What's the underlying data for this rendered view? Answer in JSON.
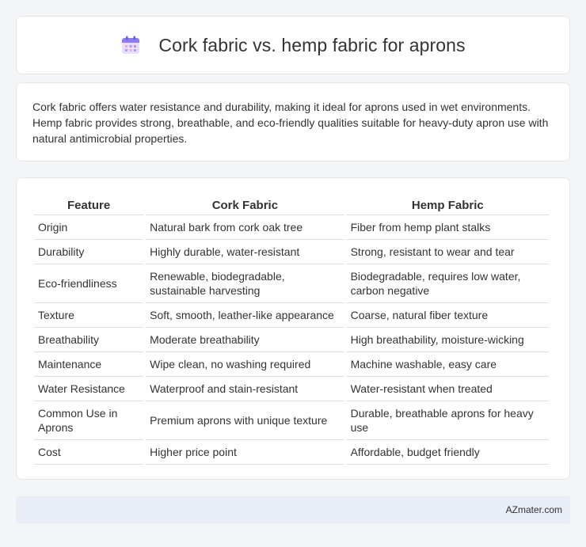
{
  "header": {
    "title": "Cork fabric vs. hemp fabric for aprons",
    "icon": "calendar-icon"
  },
  "intro": {
    "text": "Cork fabric offers water resistance and durability, making it ideal for aprons used in wet environments. Hemp fabric provides strong, breathable, and eco-friendly qualities suitable for heavy-duty apron use with natural antimicrobial properties."
  },
  "table": {
    "headers": [
      "Feature",
      "Cork Fabric",
      "Hemp Fabric"
    ],
    "rows": [
      [
        "Origin",
        "Natural bark from cork oak tree",
        "Fiber from hemp plant stalks"
      ],
      [
        "Durability",
        "Highly durable, water-resistant",
        "Strong, resistant to wear and tear"
      ],
      [
        "Eco-friendliness",
        "Renewable, biodegradable, sustainable harvesting",
        "Biodegradable, requires low water, carbon negative"
      ],
      [
        "Texture",
        "Soft, smooth, leather-like appearance",
        "Coarse, natural fiber texture"
      ],
      [
        "Breathability",
        "Moderate breathability",
        "High breathability, moisture-wicking"
      ],
      [
        "Maintenance",
        "Wipe clean, no washing required",
        "Machine washable, easy care"
      ],
      [
        "Water Resistance",
        "Waterproof and stain-resistant",
        "Water-resistant when treated"
      ],
      [
        "Common Use in Aprons",
        "Premium aprons with unique texture",
        "Durable, breathable aprons for heavy use"
      ],
      [
        "Cost",
        "Higher price point",
        "Affordable, budget friendly"
      ]
    ]
  },
  "footer": {
    "brand": "AZmater.com"
  }
}
